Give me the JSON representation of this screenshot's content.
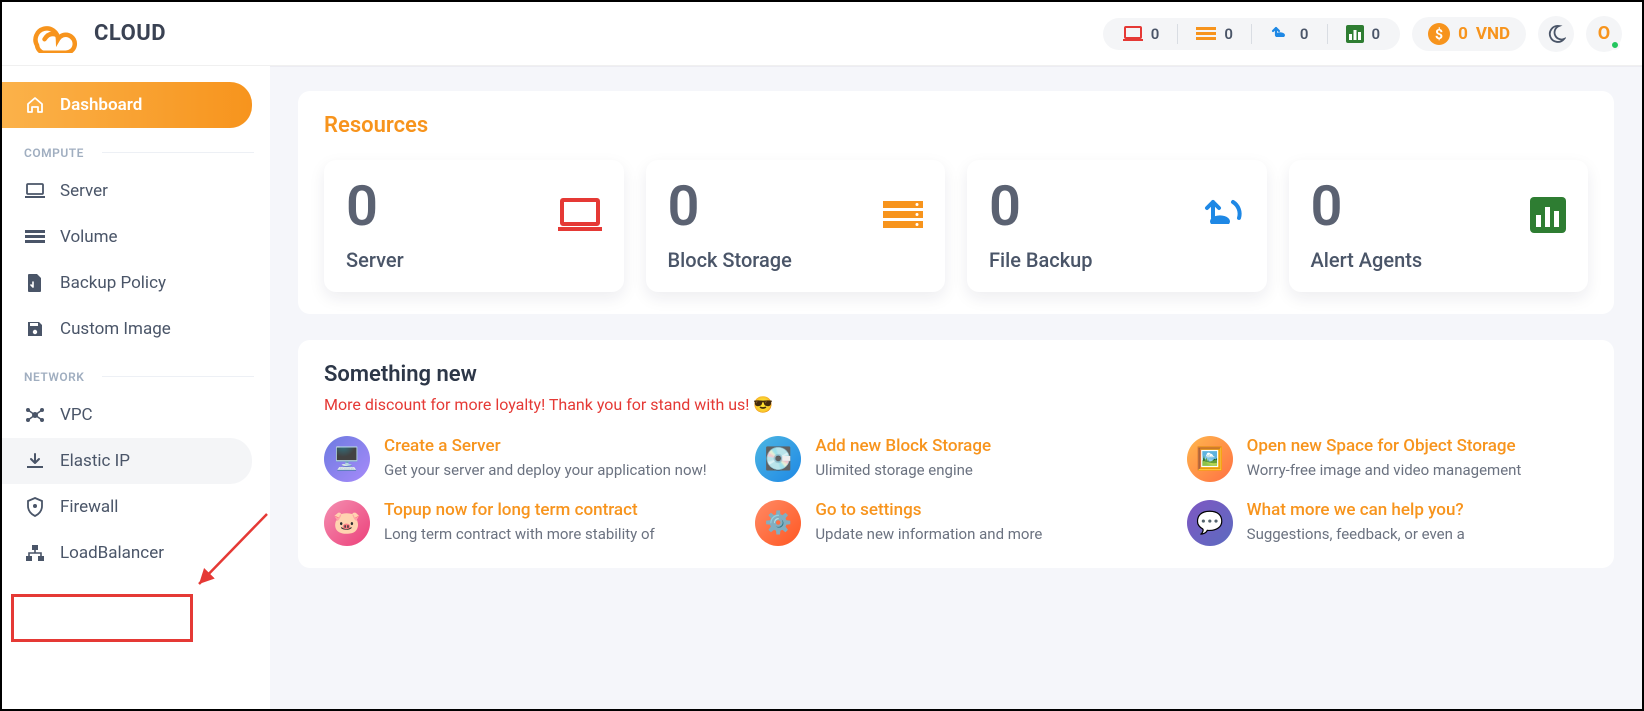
{
  "brand": {
    "word": "CLOUD"
  },
  "header": {
    "stats": [
      {
        "icon": "laptop",
        "value": "0",
        "color": "#e53935"
      },
      {
        "icon": "list",
        "value": "0",
        "color": "#f7941d"
      },
      {
        "icon": "backup",
        "value": "0",
        "color": "#1e88e5"
      },
      {
        "icon": "chart",
        "value": "0",
        "color": "#2e7d32"
      }
    ],
    "balance": {
      "amount": "0",
      "currency": "VND"
    },
    "avatar_initial": "O"
  },
  "sidebar": {
    "dashboard_label": "Dashboard",
    "compute_label": "COMPUTE",
    "network_label": "NETWORK",
    "compute_items": [
      {
        "icon": "laptop",
        "label": "Server"
      },
      {
        "icon": "list",
        "label": "Volume"
      },
      {
        "icon": "doc",
        "label": "Backup Policy"
      },
      {
        "icon": "save",
        "label": "Custom Image"
      }
    ],
    "network_items": [
      {
        "icon": "nodes",
        "label": "VPC"
      },
      {
        "icon": "down",
        "label": "Elastic IP",
        "hover": true
      },
      {
        "icon": "shield",
        "label": "Firewall"
      },
      {
        "icon": "tree",
        "label": "LoadBalancer"
      }
    ]
  },
  "content": {
    "resources_title": "Resources",
    "cards": [
      {
        "value": "0",
        "label": "Server",
        "icon": "laptop",
        "color": "#e53935"
      },
      {
        "value": "0",
        "label": "Block Storage",
        "icon": "list",
        "color": "#f7941d"
      },
      {
        "value": "0",
        "label": "File Backup",
        "icon": "backup",
        "color": "#1e88e5"
      },
      {
        "value": "0",
        "label": "Alert Agents",
        "icon": "chart",
        "color": "#2e7d32"
      }
    ],
    "something_new_title": "Something new",
    "promo_text": "More discount for more loyalty! Thank you for stand with us! ",
    "promo_emoji": "😎",
    "actions": [
      {
        "title": "Create a Server",
        "desc": "Get your server and deploy your application now!",
        "img_bg": "#6c7ae0"
      },
      {
        "title": "Add new Block Storage",
        "desc": "Ulimited storage engine",
        "img_bg": "#4db6e2"
      },
      {
        "title": "Open new Space for Object Storage",
        "desc": "Worry-free image and video management",
        "img_bg": "#ffb74d"
      },
      {
        "title": "Topup now for long term contract",
        "desc": "Long term contract with more stability of",
        "img_bg": "#f48fb1"
      },
      {
        "title": "Go to settings",
        "desc": "Update new information and more",
        "img_bg": "#ff8a65"
      },
      {
        "title": "What more we can help you?",
        "desc": "Suggestions, feedback, or even a",
        "img_bg": "#7e57c2"
      }
    ]
  }
}
